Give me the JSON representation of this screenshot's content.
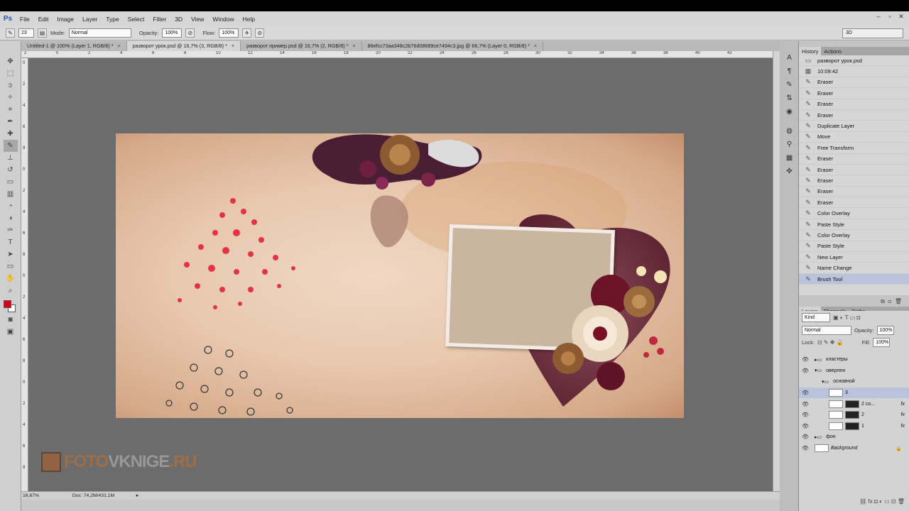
{
  "app": {
    "logo": "Ps"
  },
  "menu": [
    "File",
    "Edit",
    "Image",
    "Layer",
    "Type",
    "Select",
    "Filter",
    "3D",
    "View",
    "Window",
    "Help"
  ],
  "window_controls": [
    "–",
    "▫",
    "✕"
  ],
  "options": {
    "brush_size": "23",
    "mode_label": "Mode:",
    "mode_value": "Normal",
    "opacity_label": "Opacity:",
    "opacity_value": "100%",
    "flow_label": "Flow:",
    "flow_value": "100%",
    "workspace": "3D"
  },
  "tabs": [
    {
      "label": "Untitled-1 @ 100% (Layer 1, RGB/8) *",
      "active": false
    },
    {
      "label": "разворот урок.psd @ 16,7% (3, RGB/8) *",
      "active": true
    },
    {
      "label": "разворот пример.psd @ 16,7% (2, RGB/8) *",
      "active": false
    },
    {
      "label": "86efcc73aa348c2b76d08689ce7494c3.jpg @ 66,7% (Layer 0, RGB/8) *",
      "active": false
    }
  ],
  "ruler_h": [
    "2",
    "0",
    "2",
    "4",
    "6",
    "8",
    "10",
    "12",
    "14",
    "16",
    "18",
    "20",
    "22",
    "24",
    "26",
    "28",
    "30",
    "32",
    "34",
    "36",
    "38",
    "40",
    "42"
  ],
  "ruler_v": [
    "0",
    "2",
    "4",
    "6",
    "8",
    "0",
    "2",
    "4",
    "6",
    "8",
    "0",
    "2",
    "4",
    "6",
    "8",
    "0",
    "2",
    "4",
    "6",
    "8"
  ],
  "status": {
    "zoom": "16,67%",
    "doc": "Doc: 74,2M/431,1M"
  },
  "watermark": {
    "part1": "FOTO",
    "part2": "VKNIGE",
    "part3": ".RU"
  },
  "history_panel": {
    "tabs": [
      "History",
      "Actions"
    ],
    "snapshot_name": "разворот урок.psd",
    "snapshot_time": "10:09:42",
    "items": [
      "Eraser",
      "Eraser",
      "Eraser",
      "Eraser",
      "Duplicate Layer",
      "Move",
      "Free Transform",
      "Eraser",
      "Eraser",
      "Eraser",
      "Eraser",
      "Eraser",
      "Color Overlay",
      "Paste Style",
      "Color Overlay",
      "Paste Style",
      "New Layer",
      "Name Change",
      "Brush Tool"
    ],
    "selected_index": 18
  },
  "layers_panel": {
    "tabs": [
      "Layers",
      "Channels",
      "Paths"
    ],
    "kind": "Kind",
    "blend_mode": "Normal",
    "opacity_label": "Opacity:",
    "opacity_value": "100%",
    "lock_label": "Lock:",
    "fill_label": "Fill:",
    "fill_value": "100%",
    "layers": [
      {
        "name": "кластеры",
        "type": "group",
        "indent": 0,
        "visible": true,
        "expanded": false
      },
      {
        "name": "оверлеи",
        "type": "group",
        "indent": 0,
        "visible": true,
        "expanded": true
      },
      {
        "name": "основной",
        "type": "group",
        "indent": 1,
        "visible": false,
        "expanded": true
      },
      {
        "name": "3",
        "type": "layer",
        "indent": 2,
        "visible": true,
        "selected": true
      },
      {
        "name": "2 co...",
        "type": "layer-mask",
        "indent": 2,
        "visible": true,
        "fx": "fx"
      },
      {
        "name": "2",
        "type": "layer-mask",
        "indent": 2,
        "visible": true,
        "fx": "fx"
      },
      {
        "name": "1",
        "type": "layer-mask",
        "indent": 2,
        "visible": true,
        "fx": "fx"
      },
      {
        "name": "фон",
        "type": "group",
        "indent": 0,
        "visible": true,
        "expanded": false
      },
      {
        "name": "Background",
        "type": "background",
        "indent": 0,
        "visible": true,
        "locked": true
      }
    ]
  },
  "colors": {
    "foreground": "#d9001b",
    "background": "#ffffff",
    "accent_selection": "#b9c3db"
  }
}
